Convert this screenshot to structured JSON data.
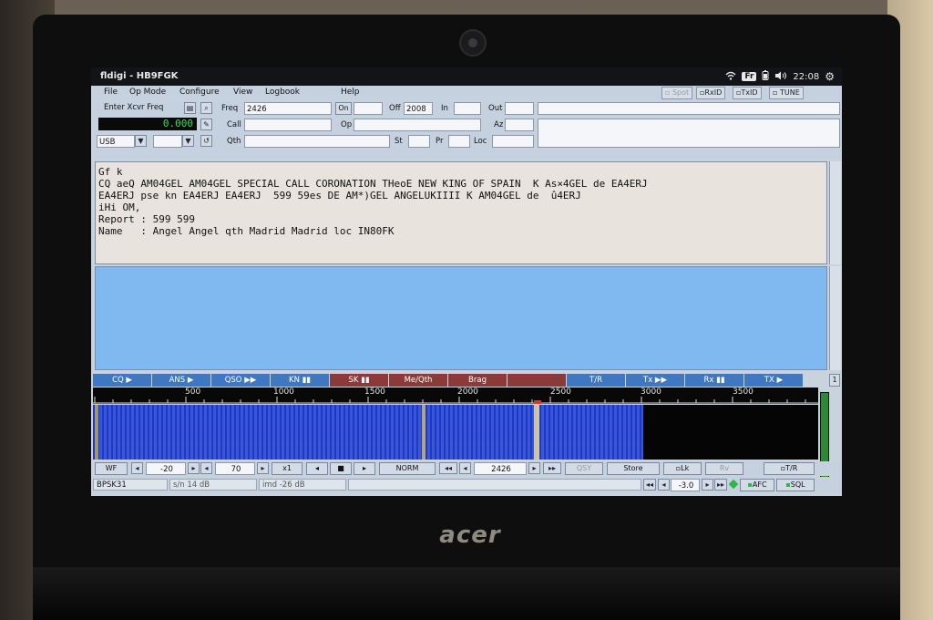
{
  "window": {
    "title": "fldigi - HB9FGK",
    "keyboard": "Fr",
    "clock": "22:08"
  },
  "menu": [
    "File",
    "Op Mode",
    "Configure",
    "View",
    "Logbook",
    "Help"
  ],
  "toggles": [
    "Spot",
    "RxID",
    "TxID",
    "TUNE"
  ],
  "logbar": {
    "enter_freq_label": "Enter Xcvr Freq",
    "freq_display": "0.000",
    "mode": "USB",
    "freq_label": "Freq",
    "freq_value": "2426",
    "on_label": "On",
    "off_label": "Off",
    "off_value": "2008",
    "in_label": "In",
    "out_label": "Out",
    "call_label": "Call",
    "op_label": "Op",
    "az_label": "Az",
    "qth_label": "Qth",
    "st_label": "St",
    "pr_label": "Pr",
    "loc_label": "Loc"
  },
  "rx_text": [
    "Gf k",
    "CQ aeQ AM04GEL AM04GEL SPECIAL CALL CORONATION THeoE NEW KING OF SPAIN  K As×4GEL de EA4ERJ",
    "EA4ERJ pse kn EA4ERJ EA4ERJ  599 59es DE AM*)GEL ANGELUKIIII K AM04GEL de  û4ERJ",
    "iHi OM,",
    "Report : 599 599",
    "Name   : Angel Angel qth Madrid Madrid loc IN80FK"
  ],
  "macros": [
    {
      "label": "CQ ▶",
      "color": "blue"
    },
    {
      "label": "ANS ▶",
      "color": "blue"
    },
    {
      "label": "QSO ▶▶",
      "color": "blue"
    },
    {
      "label": "KN ▮▮",
      "color": "blue"
    },
    {
      "label": "SK ▮▮",
      "color": "red"
    },
    {
      "label": "Me/Qth",
      "color": "red"
    },
    {
      "label": "Brag",
      "color": "red"
    },
    {
      "label": "",
      "color": "red"
    },
    {
      "label": "T/R",
      "color": "blue"
    },
    {
      "label": "Tx ▶▶",
      "color": "blue"
    },
    {
      "label": "Rx ▮▮",
      "color": "blue"
    },
    {
      "label": "TX ▶",
      "color": "blue"
    }
  ],
  "macro_page": "1",
  "scale_ticks": [
    "500",
    "1000",
    "1500",
    "2000",
    "2500",
    "3000",
    "3500"
  ],
  "controls": {
    "wf_label": "WF",
    "low_db": "-20",
    "range_db": "70",
    "zoom": "x1",
    "norm_label": "NORM",
    "carrier": "2426",
    "qsy_label": "QSY",
    "store_label": "Store",
    "lk_label": "Lk",
    "rv_label": "Rv",
    "tr_label": "T/R"
  },
  "status": {
    "mode": "BPSK31",
    "snr": "s/n 14 dB",
    "imd": "imd -26 dB",
    "squelch": "-3.0",
    "afc_label": "AFC",
    "sql_label": "SQL"
  },
  "laptop_brand": "acer",
  "colors": {
    "tx_pane": "#7fb9f0",
    "macro_blue": "#3e78c3",
    "macro_red": "#8b3a3a",
    "waterfall": "#2a4fd2",
    "freq_digits": "#27e05a"
  }
}
